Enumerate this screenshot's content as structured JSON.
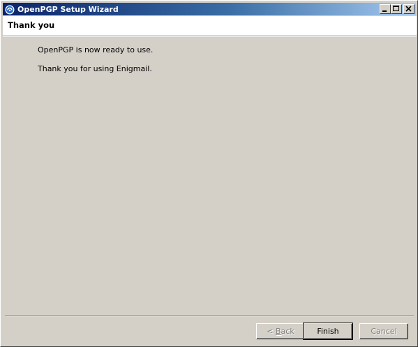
{
  "window": {
    "title": "OpenPGP Setup Wizard",
    "app_icon": "enigmail-icon"
  },
  "titlebar_buttons": {
    "minimize": "minimize-icon",
    "maximize": "maximize-icon",
    "close": "close-icon"
  },
  "page": {
    "heading": "Thank you",
    "lines": [
      "OpenPGP is now ready to use.",
      "Thank you for using Enigmail."
    ]
  },
  "buttons": {
    "back_arrow": "< ",
    "back_accel": "B",
    "back_rest": "ack",
    "finish": "Finish",
    "cancel": "Cancel"
  },
  "colors": {
    "titlebar_start": "#0a246a",
    "titlebar_end": "#a6caf0",
    "dialog_bg": "#d4d0c8",
    "header_bg": "#ffffff"
  }
}
